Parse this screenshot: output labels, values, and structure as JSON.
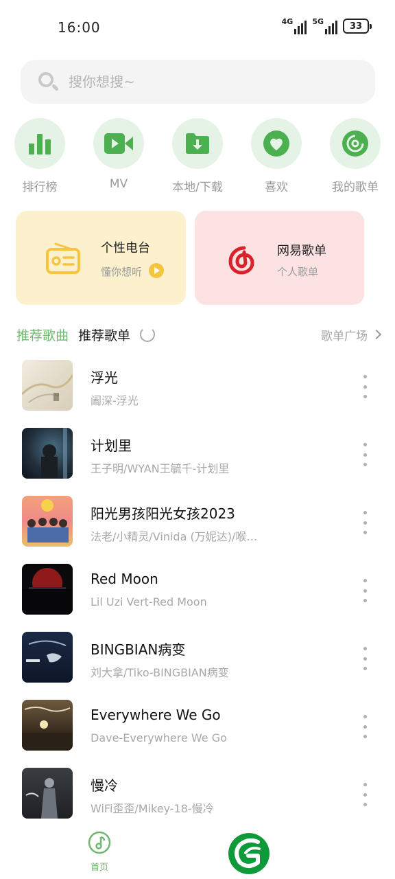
{
  "status_bar": {
    "time": "16:00",
    "network_1": "4G",
    "network_2": "5G",
    "battery": "33"
  },
  "search": {
    "placeholder": "搜你想搜~"
  },
  "shortcuts": [
    {
      "label": "排行榜",
      "icon": "bar-chart-icon"
    },
    {
      "label": "MV",
      "icon": "video-camera-icon"
    },
    {
      "label": "本地/下载",
      "icon": "download-folder-icon"
    },
    {
      "label": "喜欢",
      "icon": "heart-icon"
    },
    {
      "label": "我的歌单",
      "icon": "disc-icon"
    }
  ],
  "cards": {
    "radio": {
      "title": "个性电台",
      "subtitle": "懂你想听",
      "icon": "radio-icon"
    },
    "netease": {
      "title": "网易歌单",
      "subtitle": "个人歌单",
      "icon": "netease-music-icon"
    }
  },
  "section": {
    "tab_songs": "推荐歌曲",
    "tab_playlists": "推荐歌单",
    "more_link": "歌单广场"
  },
  "songs": [
    {
      "title": "浮光",
      "artist": "阖深-浮光"
    },
    {
      "title": "计划里",
      "artist": "王子明/WYAN王毓千-计划里"
    },
    {
      "title": "阳光男孩阳光女孩2023",
      "artist": "法老/小精灵/Vinida (万妮达)/喉…"
    },
    {
      "title": "Red Moon",
      "artist": "Lil Uzi Vert-Red Moon"
    },
    {
      "title": "BINGBIAN病变",
      "artist": "刘大拿/Tiko-BINGBIAN病变"
    },
    {
      "title": "Everywhere We Go",
      "artist": "Dave-Everywhere We Go"
    },
    {
      "title": "慢冷",
      "artist": "WiFi歪歪/Mikey-18-慢冷"
    }
  ],
  "bottom_nav": {
    "home_label": "首页"
  },
  "colors": {
    "accent_green": "#6fb86f",
    "icon_green": "#4caf50",
    "radio_yellow": "#f5c542",
    "netease_red": "#d8232a"
  }
}
